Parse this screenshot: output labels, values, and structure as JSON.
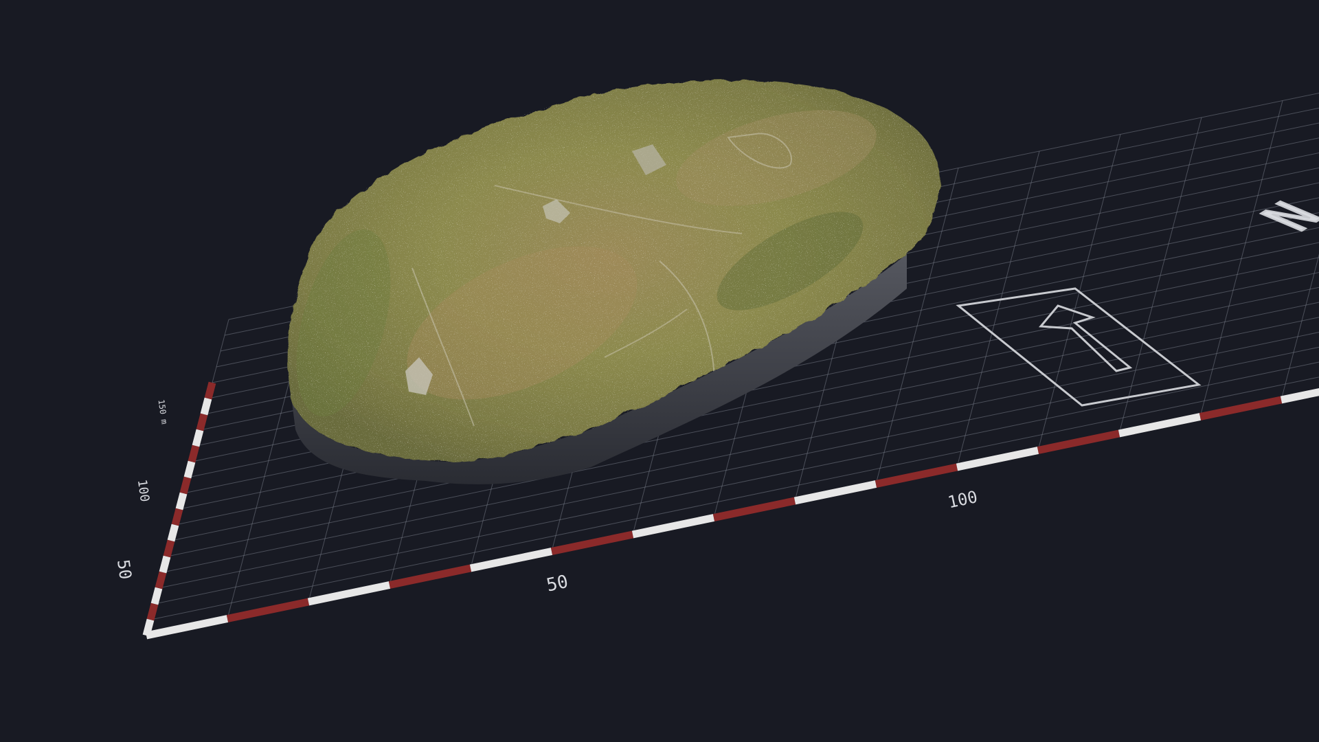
{
  "scene": {
    "background_color": "#181a23",
    "grid_color": "#8a8f9c",
    "grid_cell_m": 10,
    "grid_extent_m": [
      200,
      200
    ]
  },
  "model": {
    "icon": "terrain-model",
    "surface_colors": [
      "#8e8a4e",
      "#7c7a44",
      "#9b8856",
      "#a49162",
      "#6f7340"
    ],
    "base_color": "#3b3d46"
  },
  "scale_x": {
    "bar_colors": [
      "#e7e7e7",
      "#8b2a2a"
    ],
    "labels": [
      "50",
      "100",
      "150 m"
    ]
  },
  "scale_y": {
    "bar_colors": [
      "#e7e7e7",
      "#8b2a2a"
    ],
    "labels": [
      "50",
      "100",
      "150 m"
    ]
  },
  "north_arrow": {
    "icon": "north-arrow-icon",
    "letter": "N",
    "color": "#c8cacf"
  }
}
